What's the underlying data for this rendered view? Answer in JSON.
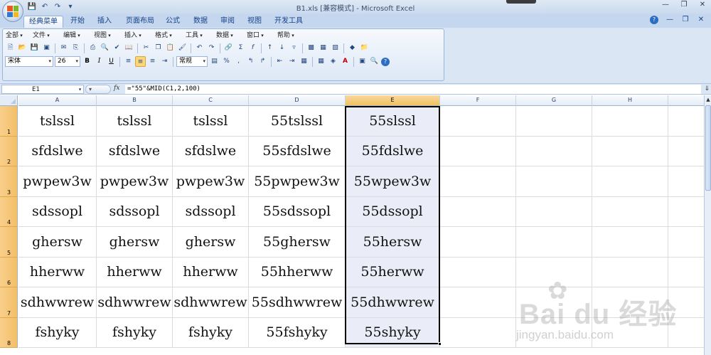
{
  "window": {
    "title_file": "B1.xls",
    "title_mode": "[兼容模式]",
    "title_app": "Microsoft Excel",
    "dash": "-"
  },
  "quick_access": [
    "save-icon",
    "undo-icon",
    "redo-icon",
    "customize-icon"
  ],
  "ribbon_tabs": [
    "经典菜单",
    "开始",
    "插入",
    "页面布局",
    "公式",
    "数据",
    "审阅",
    "视图",
    "开发工具"
  ],
  "classic_menu": [
    "全部",
    "文件",
    "编辑",
    "视图",
    "插入",
    "格式",
    "工具",
    "数据",
    "窗口",
    "帮助"
  ],
  "font": {
    "name": "宋体",
    "size": "26"
  },
  "number_format": "常规",
  "format_labels": {
    "bold": "B",
    "italic": "I",
    "underline": "U",
    "percent": "%",
    "comma": ","
  },
  "formula_bar": {
    "name_box": "E1",
    "fx_label": "fx",
    "formula": "=\"55\"&MID(C1,2,100)"
  },
  "columns": [
    "A",
    "B",
    "C",
    "D",
    "E",
    "F",
    "G",
    "H"
  ],
  "rows": [
    "1",
    "2",
    "3",
    "4",
    "5",
    "6",
    "7",
    "8"
  ],
  "selected_column": "E",
  "cells": [
    [
      "tslssl",
      "tslssl",
      "tslssl",
      "55tslssl",
      "55slssl"
    ],
    [
      "sfdslwe",
      "sfdslwe",
      "sfdslwe",
      "55sfdslwe",
      "55fdslwe"
    ],
    [
      "pwpew3w",
      "pwpew3w",
      "pwpew3w",
      "55pwpew3w",
      "55wpew3w"
    ],
    [
      "sdssopl",
      "sdssopl",
      "sdssopl",
      "55sdssopl",
      "55dssopl"
    ],
    [
      "ghersw",
      "ghersw",
      "ghersw",
      "55ghersw",
      "55hersw"
    ],
    [
      "hherww",
      "hherww",
      "hherww",
      "55hherww",
      "55herww"
    ],
    [
      "sdhwwrew",
      "sdhwwrew",
      "sdhwwrew",
      "55sdhwwrew",
      "55dhwwrew"
    ],
    [
      "fshyky",
      "fshyky",
      "fshyky",
      "55fshyky",
      "55shyky"
    ]
  ],
  "watermark": {
    "brand": "Bai du 经验",
    "url": "jingyan.baidu.com"
  },
  "colors": {
    "selection_fill": "#eaedf7",
    "row_header_selected": "#f3bf68",
    "ribbon_bg": "#dbe6f4"
  }
}
